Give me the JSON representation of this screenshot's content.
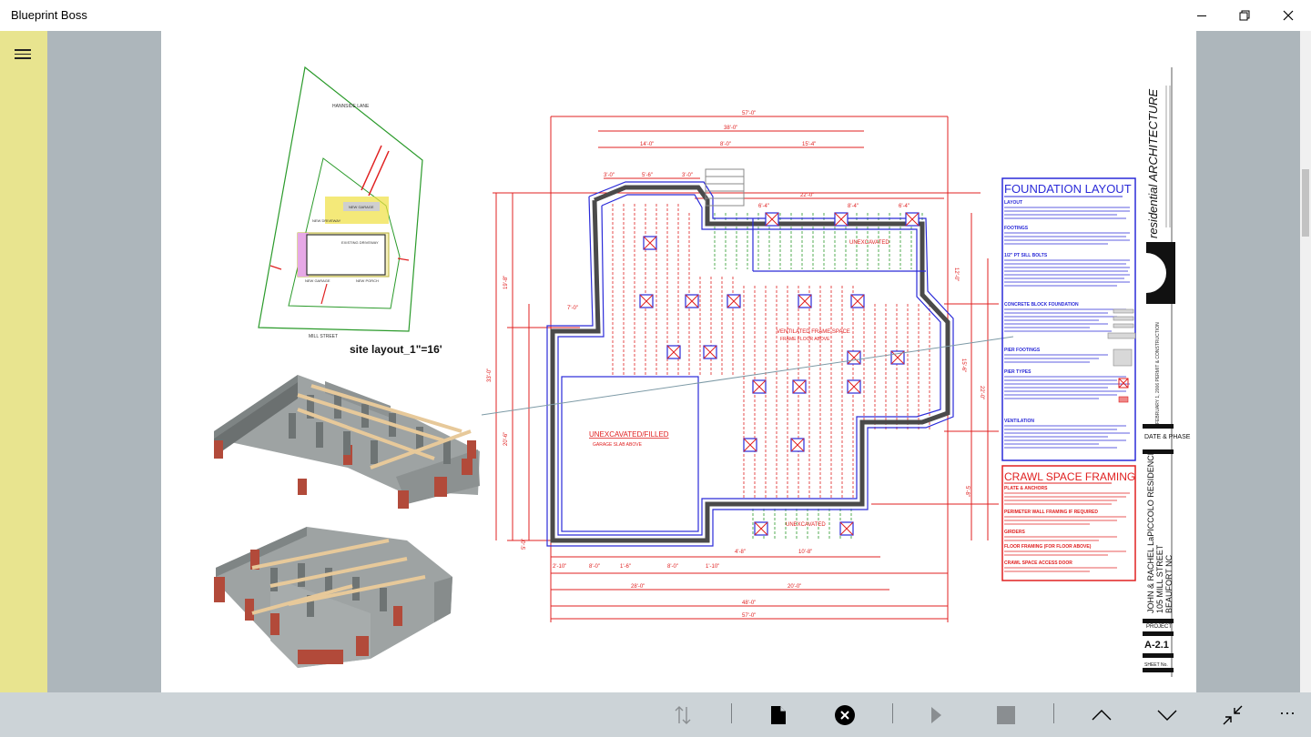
{
  "app": {
    "title": "Blueprint Boss"
  },
  "window": {
    "minimize": "—",
    "restore": "❐",
    "close": "✕"
  },
  "drawing": {
    "site_street_top": "HANNSIDE LANE",
    "site_street_bottom": "MILL STREET",
    "site_caption": "site layout_1\"=16'",
    "site_labels": [
      "NEW GARAGE",
      "NEW DRIVEWAY",
      "EXISTING DRIVEWAY",
      "NEW GARAGE",
      "NEW PORCH"
    ],
    "dims_top": [
      "57'-0\"",
      "38'-0\"",
      "14'-0\"",
      "8'-0\"",
      "15'-4\"",
      "3'-0\"",
      "5'-6\"",
      "3'-0\"",
      "22'-0\"",
      "6'-4\"",
      "8'-4\"",
      "6'-4\""
    ],
    "dims_bottom": [
      "2'-10\"",
      "8'-0\"",
      "1'-6\"",
      "8'-0\"",
      "1'-10\"",
      "4'-8\"",
      "10'-8\"",
      "28'-0\"",
      "20'-0\"",
      "48'-0\"",
      "57'-0\""
    ],
    "dims_left": [
      "19'-8\"",
      "33'-0\"",
      "20'-6\"",
      "7'-0\"",
      "5'-0\""
    ],
    "dims_right": [
      "12'-0\"",
      "15'-6\"",
      "22'-0\"",
      "5'-8\""
    ],
    "notes": [
      "UNEXCAVATED/FILLED",
      "GARAGE SLAB ABOVE",
      "VENTILATED FRAME SPACE",
      "FRAME FLOOR ABOVE",
      "UNEXCAVATED",
      "UNEXCAVATED"
    ],
    "foundation_title": "FOUNDATION LAYOUT",
    "foundation_sections": [
      "LAYOUT",
      "FOOTINGS",
      "1/2\" PT SILL BOLTS",
      "CONCRETE BLOCK FOUNDATION",
      "PIER FOOTINGS",
      "PIER TYPES",
      "VENTILATION"
    ],
    "crawl_title": "CRAWL SPACE FRAMING",
    "crawl_sections": [
      "PLATE & ANCHORS",
      "PERIMETER WALL FRAMING IF REQUIRED",
      "GIRDERS",
      "FLOOR FRAMING (FOR FLOOR ABOVE)",
      "CRAWL SPACE ACCESS DOOR"
    ],
    "firm_brand": "residential ARCHITECTURE",
    "date_line": "FEBRUARY 1, 2006 PERMIT & CONSTRUCTION",
    "date_phase": "DATE & PHASE",
    "project_name": "JOHN & RACHEL LaPICCOLO RESIDENCE",
    "project_address": "105 MILL STREET",
    "project_city": "BEAUFORT NC",
    "project_label": "PROJECT",
    "sheet_number": "A-2.1",
    "sheet_label": "SHEET No."
  },
  "toolbar": {
    "sort_icon": "sort-arrows-icon",
    "page_icon": "document-icon",
    "close_icon": "close-circle-icon",
    "play_icon": "play-icon",
    "stop_icon": "stop-icon",
    "up_icon": "chevron-up-icon",
    "down_icon": "chevron-down-icon",
    "collapse_icon": "collapse-arrows-icon",
    "more": "···"
  },
  "colors": {
    "sidebar": "#e8e48f",
    "viewer_bg": "#adb6bb",
    "bottombar": "#ccd3d7",
    "plan_red": "#e02020",
    "plan_blue": "#2a2ad8",
    "plan_green": "#2a9a2a"
  }
}
